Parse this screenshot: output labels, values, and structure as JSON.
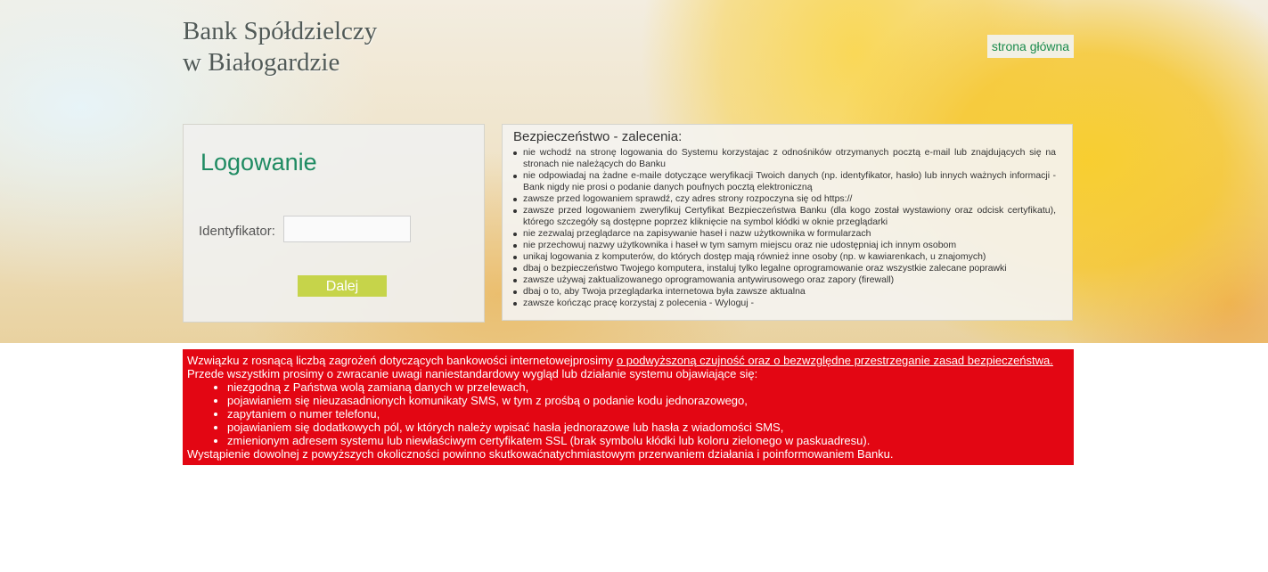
{
  "header": {
    "bank_name_line1": "Bank Spółdzielczy",
    "bank_name_line2": "w Białogardzie",
    "home_link": "strona główna"
  },
  "login": {
    "title": "Logowanie",
    "identifier_label": "Identyfikator:",
    "identifier_value": "",
    "identifier_placeholder": "",
    "submit_label": "Dalej"
  },
  "security": {
    "title": "Bezpieczeństwo - zalecenia:",
    "items": [
      "nie wchodź na stronę logowania do Systemu korzystajac z odnośników otrzymanych pocztą e-mail lub znajdujących się na stronach nie należących do Banku",
      "nie odpowiadaj na żadne e-maile dotyczące weryfikacji Twoich danych (np. identyfikator, hasło) lub innych ważnych informacji - Bank nigdy nie prosi o podanie danych poufnych pocztą elektroniczną",
      "zawsze przed logowaniem sprawdź, czy adres strony rozpoczyna się od https://",
      "zawsze przed logowaniem zweryfikuj Certyfikat Bezpieczeństwa Banku (dla kogo został wystawiony oraz odcisk certyfikatu), którego szczegóły są dostępne poprzez kliknięcie na symbol kłódki w oknie przeglądarki",
      "nie zezwalaj przeglądarce na zapisywanie haseł i nazw użytkownika w formularzach",
      "nie przechowuj nazwy użytkownika i haseł w tym samym miejscu oraz nie udostępniaj ich innym osobom",
      "unikaj logowania z komputerów, do których dostęp mają również inne osoby (np. w kawiarenkach, u znajomych)",
      "dbaj o bezpieczeństwo Twojego komputera, instaluj tylko legalne oprogramowanie oraz wszystkie zalecane poprawki",
      "zawsze używaj zaktualizowanego oprogramowania antywirusowego oraz zapory (firewall)",
      "dbaj o to, aby Twoja przeglądarka internetowa była zawsze aktualna",
      "zawsze kończąc pracę korzystaj z polecenia - Wyloguj -"
    ]
  },
  "alert": {
    "intro": "Wzwiązku z rosnącą liczbą zagrożeń dotyczących bankowości internetowejprosimy ",
    "intro_link": "o podwyższoną czujność oraz o bezwzględne przestrzeganie zasad bezpieczeństwa.",
    "line2": "Przede wszystkim prosimy o zwracanie uwagi naniestandardowy wygląd lub działanie systemu objawiające się:",
    "items": [
      "niezgodną z Państwa wolą zamianą danych w przelewach,",
      "pojawianiem się nieuzasadnionych komunikaty SMS, w tym z prośbą o podanie kodu jednorazowego,",
      "zapytaniem o numer telefonu,",
      "pojawianiem się dodatkowych pól, w których należy wpisać hasła jednorazowe lub hasła z wiadomości SMS,",
      "zmienionym adresem systemu lub niewłaściwym certyfikatem SSL (brak symbolu kłódki lub koloru zielonego w paskuadresu)."
    ],
    "footer": "Wystąpienie dowolnej z powyższych okoliczności powinno skutkowaćnatychmiastowym przerwaniem działania i poinformowaniem Banku."
  },
  "colors": {
    "accent_green": "#1f8b62",
    "button_lime": "#c6d44a",
    "alert_red": "#e30613"
  }
}
